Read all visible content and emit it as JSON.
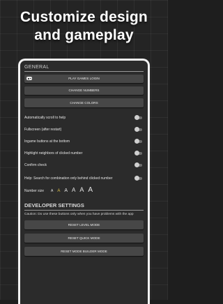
{
  "headline": {
    "line1": "Customize design",
    "line2": "and gameplay"
  },
  "general": {
    "title": "GENERAL",
    "buttons": {
      "play_games_login": "PLAY GAMES LOGIN",
      "change_numbers": "CHANGE NUMBERS",
      "change_colors": "CHANGE COLORS"
    },
    "toggles": [
      {
        "label": "Automatically scroll to help",
        "on": false
      },
      {
        "label": "Fullscreen (after restart)",
        "on": false
      },
      {
        "label": "Ingame buttons at the bottom",
        "on": false
      },
      {
        "label": "Highlight neighbors of clicked number",
        "on": false
      },
      {
        "label": "Confirm check",
        "on": false
      },
      {
        "label": "Help: Search for combination only behind clicked number",
        "on": false
      }
    ],
    "number_size": {
      "label": "Number size",
      "options": [
        "A",
        "A",
        "A",
        "A",
        "A",
        "A"
      ],
      "selected_index": 1
    }
  },
  "developer": {
    "title": "DEVELOPER SETTINGS",
    "caution": "Caution: Do use these buttons only when you have problems with the app",
    "buttons": {
      "reset_level_mode": "RESET LEVEL MODE",
      "reset_quick_mode": "RESET QUICK MODE",
      "reset_mode_builder": "RESET MODE BUILDER MODE"
    }
  },
  "colors": {
    "accent_selected": "#e6c84a",
    "button_bg": "#474747",
    "panel_bg": "#2b2b2b"
  }
}
